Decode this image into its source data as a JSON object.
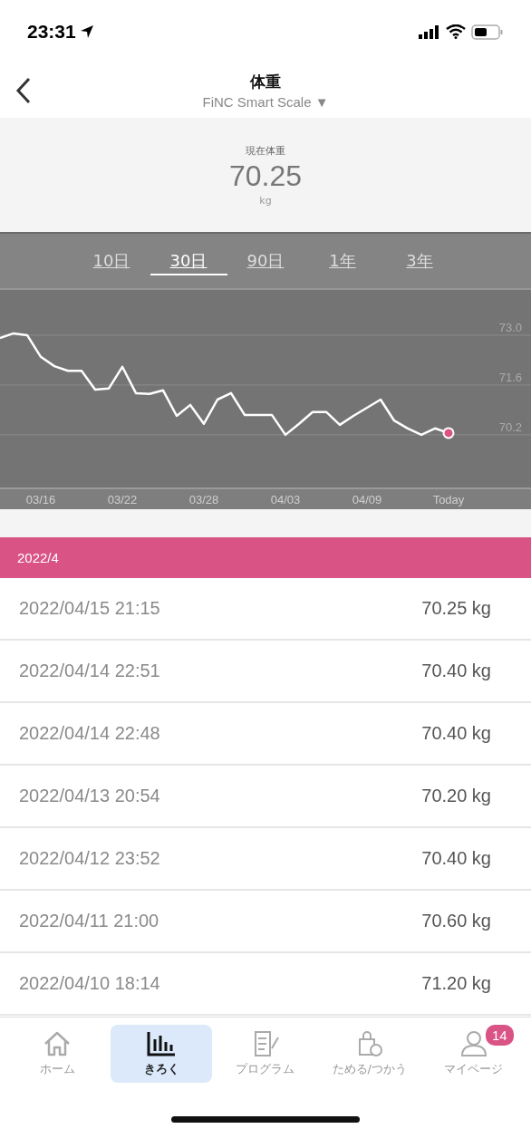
{
  "status_bar": {
    "time": "23:31"
  },
  "header": {
    "title": "体重",
    "subtitle": "FiNC Smart Scale ▼"
  },
  "current": {
    "label": "現在体重",
    "value": "70.25",
    "unit": "kg"
  },
  "range_tabs": [
    {
      "label": "10日",
      "selected": false
    },
    {
      "label": "30日",
      "selected": true
    },
    {
      "label": "90日",
      "selected": false
    },
    {
      "label": "1年",
      "selected": false
    },
    {
      "label": "3年",
      "selected": false
    }
  ],
  "chart_data": {
    "type": "line",
    "categories": [
      null,
      null,
      null,
      "03/16",
      null,
      null,
      null,
      null,
      null,
      "03/22",
      null,
      null,
      null,
      null,
      null,
      "03/28",
      null,
      null,
      null,
      null,
      null,
      "04/03",
      null,
      null,
      null,
      null,
      null,
      "04/09",
      null,
      null,
      null,
      null,
      null,
      "Today"
    ],
    "ylim": [
      68.72,
      74.27
    ],
    "grid": true,
    "yticks": [
      {
        "value": 73.0,
        "label": "73.0"
      },
      {
        "value": 71.6,
        "label": "71.6"
      },
      {
        "value": 70.2,
        "label": "70.2"
      }
    ],
    "series": [
      {
        "color": "#ffffff",
        "values": [
          72.92,
          73.05,
          73.0,
          72.39,
          72.13,
          72.0,
          72.0,
          71.47,
          71.5,
          72.11,
          71.37,
          71.35,
          71.45,
          70.73,
          71.04,
          70.51,
          71.19,
          71.37,
          70.76,
          70.76,
          70.76,
          70.2,
          70.51,
          70.84,
          70.84,
          70.48,
          70.73,
          70.96,
          71.19,
          70.6,
          70.38,
          70.2,
          70.38,
          70.25
        ]
      }
    ]
  },
  "month_header": "2022/4",
  "records": [
    {
      "datetime": "2022/04/15 21:15",
      "weight": "70.25 kg"
    },
    {
      "datetime": "2022/04/14 22:51",
      "weight": "70.40 kg"
    },
    {
      "datetime": "2022/04/14 22:48",
      "weight": "70.40 kg"
    },
    {
      "datetime": "2022/04/13 20:54",
      "weight": "70.20 kg"
    },
    {
      "datetime": "2022/04/12 23:52",
      "weight": "70.40 kg"
    },
    {
      "datetime": "2022/04/11 21:00",
      "weight": "70.60 kg"
    },
    {
      "datetime": "2022/04/10 18:14",
      "weight": "71.20 kg"
    }
  ],
  "tab_bar": [
    {
      "kind": "home",
      "label": "ホーム",
      "selected": false
    },
    {
      "kind": "record",
      "label": "きろく",
      "selected": true
    },
    {
      "kind": "program",
      "label": "プログラム",
      "selected": false
    },
    {
      "kind": "points",
      "label": "ためる/つかう",
      "selected": false
    },
    {
      "kind": "mypage",
      "label": "マイページ",
      "selected": false,
      "badge": "14"
    }
  ]
}
